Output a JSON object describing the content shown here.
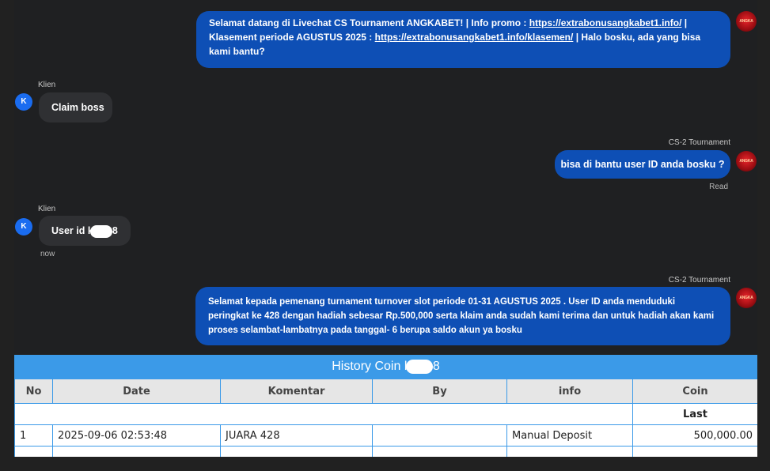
{
  "chat": {
    "agent_avatar_text": "ANGKA BET",
    "client_avatar_initial": "K",
    "messages": [
      {
        "id": "m1",
        "parts": {
          "p1": "Selamat datang di Livechat CS Tournament ANGKABET! | Info promo : ",
          "link1": "https://extrabonusangkabet1.info/",
          "p2": " | Klasement periode AGUSTUS 2025 : ",
          "link2": "https://extrabonusangkabet1.info/klasemen/",
          "p3": " | Halo bosku, ada yang bisa kami bantu?"
        }
      },
      {
        "id": "m2",
        "sender": "Klien",
        "text": "Claim boss"
      },
      {
        "id": "m3",
        "sender": "CS-2 Tournament",
        "text": "bisa di bantu user ID anda bosku ?",
        "status": "Read"
      },
      {
        "id": "m4",
        "sender": "Klien",
        "text_start": "User id k",
        "text_end": "8",
        "time": "now"
      },
      {
        "id": "m5",
        "sender": "CS-2 Tournament",
        "text": "Selamat kepada pemenang turnament turnover slot periode 01-31 AGUSTUS 2025 . User ID anda menduduki peringkat ke 428 dengan hadiah sebesar Rp.500,000 serta klaim anda sudah kami terima dan untuk hadiah akan kami proses selambat-lambatnya pada tanggal- 6 berupa saldo akun ya bosku"
      }
    ]
  },
  "history": {
    "title_start": "History Coin k",
    "title_end": "8",
    "columns": [
      "No",
      "Date",
      "Komentar",
      "By",
      "info",
      "Coin"
    ],
    "sub_header": "Last",
    "rows": [
      {
        "no": "1",
        "date": "2025-09-06 02:53:48",
        "komentar": "JUARA 428",
        "by": "",
        "info": "Manual Deposit",
        "coin": "500,000.00"
      }
    ]
  },
  "colors": {
    "agent_bubble": "#0e4fb5",
    "client_bubble": "#2f3033",
    "table_header": "#3b9ae8",
    "coin_positive": "#2e8b2e"
  }
}
